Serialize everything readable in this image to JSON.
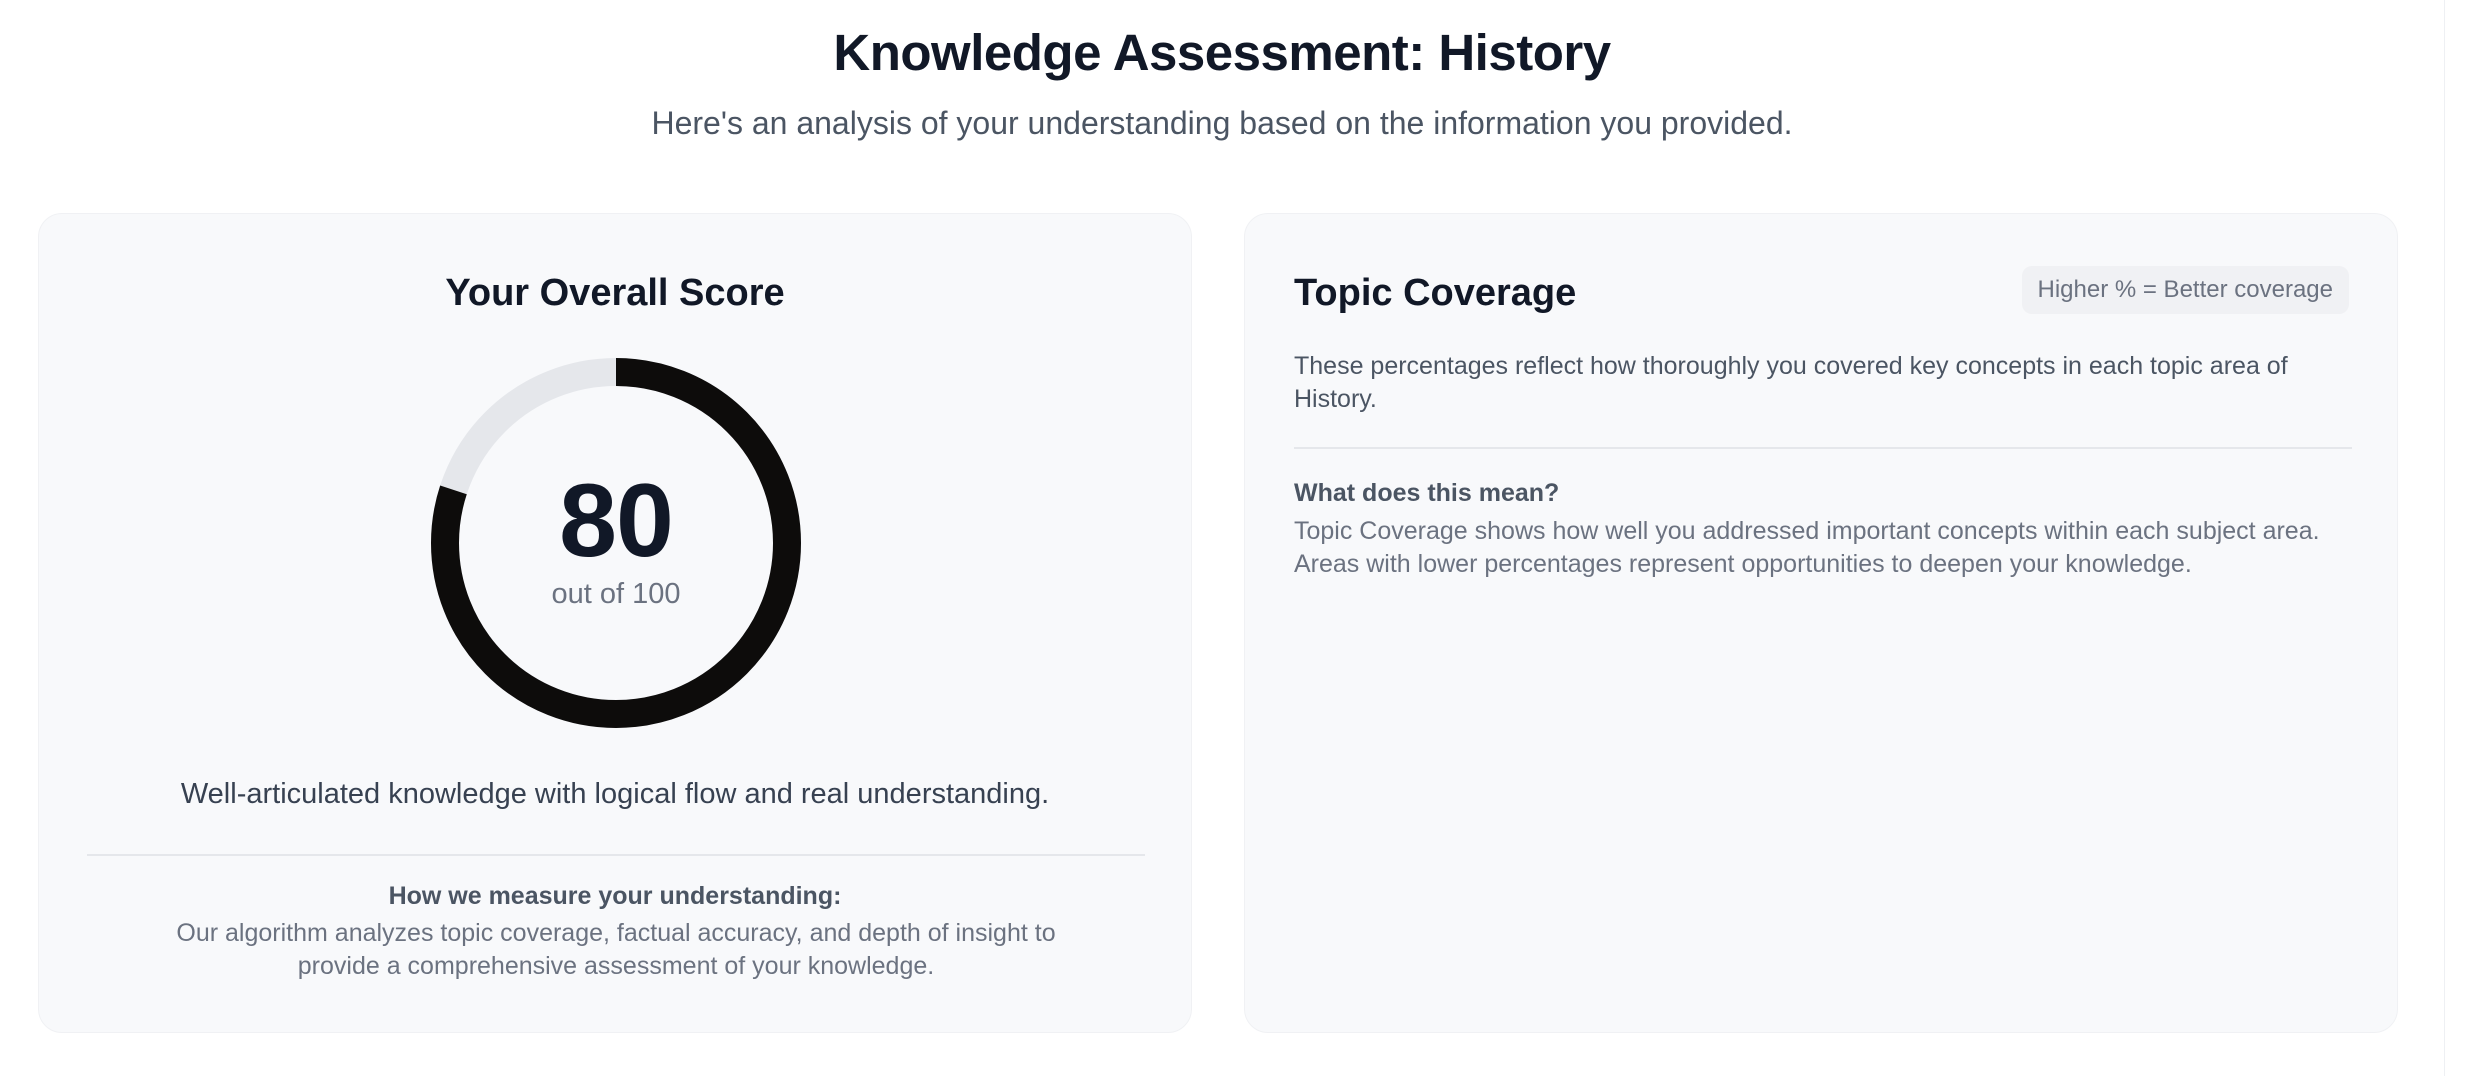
{
  "header": {
    "title": "Knowledge Assessment: History",
    "subtitle": "Here's an analysis of your understanding based on the information you provided."
  },
  "score_card": {
    "title": "Your Overall Score",
    "score": 80,
    "max_score": 100,
    "score_label": "80",
    "out_of_label": "out of 100",
    "description": "Well-articulated knowledge with logical flow and real understanding.",
    "measure_title": "How we measure your understanding:",
    "measure_text": "Our algorithm analyzes topic coverage, factual accuracy, and depth of insight to provide a comprehensive assessment of your knowledge.",
    "colors": {
      "progress": "#0d0c0b",
      "track": "#e5e7eb"
    }
  },
  "coverage_card": {
    "title": "Topic Coverage",
    "badge": "Higher % = Better coverage",
    "description": "These percentages reflect how thoroughly you covered key concepts in each topic area of History.",
    "meaning_title": "What does this mean?",
    "meaning_text": "Topic Coverage shows how well you addressed important concepts within each subject area. Areas with lower percentages represent opportunities to deepen your knowledge."
  }
}
